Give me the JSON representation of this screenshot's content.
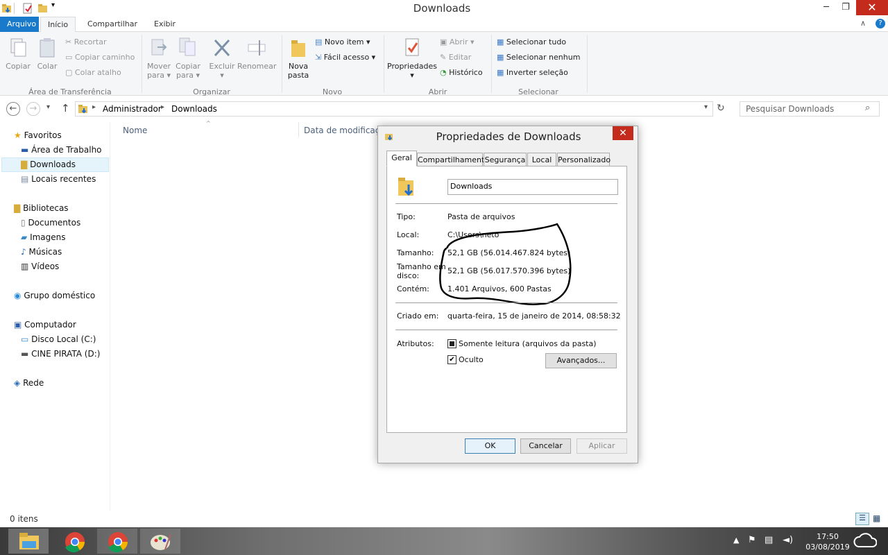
{
  "window": {
    "title": "Downloads",
    "minimize": "─",
    "maximize": "❐",
    "close": "✕"
  },
  "ribbon_tabs": [
    "Arquivo",
    "Início",
    "Compartilhar",
    "Exibir"
  ],
  "ribbon": {
    "copiar": "Copiar",
    "colar": "Colar",
    "recortar": "Recortar",
    "copiar_caminho": "Copiar caminho",
    "colar_atalho": "Colar atalho",
    "group_transferencia": "Área de Transferência",
    "mover_para_1": "Mover",
    "mover_para_2": "para",
    "copiar_para_1": "Copiar",
    "copiar_para_2": "para",
    "excluir": "Excluir",
    "renomear": "Renomear",
    "group_organizar": "Organizar",
    "nova_pasta_1": "Nova",
    "nova_pasta_2": "pasta",
    "novo_item": "Novo item",
    "facil_acesso": "Fácil acesso",
    "group_novo": "Novo",
    "propriedades": "Propriedades",
    "abrir": "Abrir",
    "editar": "Editar",
    "historico": "Histórico",
    "group_abrir": "Abrir",
    "selecionar_tudo": "Selecionar tudo",
    "selecionar_nenhum": "Selecionar nenhum",
    "inverter_selecao": "Inverter seleção",
    "group_selecionar": "Selecionar"
  },
  "address": {
    "crumb1": "Administrador",
    "crumb2": "Downloads",
    "search_placeholder": "Pesquisar Downloads"
  },
  "nav": {
    "favoritos": "Favoritos",
    "area_trabalho": "Área de Trabalho",
    "downloads": "Downloads",
    "locais_recentes": "Locais recentes",
    "bibliotecas": "Bibliotecas",
    "documentos": "Documentos",
    "imagens": "Imagens",
    "musicas": "Músicas",
    "videos": "Vídeos",
    "grupo_domestico": "Grupo doméstico",
    "computador": "Computador",
    "disco_local": "Disco Local (C:)",
    "cine_pirata": "CINE PIRATA (D:)",
    "rede": "Rede"
  },
  "columns": {
    "nome": "Nome",
    "data": "Data de modificaç..."
  },
  "status": {
    "items": "0 itens"
  },
  "dialog": {
    "title": "Propriedades de Downloads",
    "tabs": [
      "Geral",
      "Compartilhamento",
      "Segurança",
      "Local",
      "Personalizado"
    ],
    "name_value": "Downloads",
    "tipo_label": "Tipo:",
    "tipo_value": "Pasta de arquivos",
    "local_label": "Local:",
    "local_value": "C:\\Users\\neto",
    "tamanho_label": "Tamanho:",
    "tamanho_value": "52,1 GB (56.014.467.824 bytes)",
    "tamanho_disco_label_1": "Tamanho em",
    "tamanho_disco_label_2": "disco:",
    "tamanho_disco_value": "52,1 GB (56.017.570.396 bytes)",
    "contem_label": "Contém:",
    "contem_value": "1.401 Arquivos, 600 Pastas",
    "criado_label": "Criado em:",
    "criado_value": "quarta-feira, 15 de janeiro de 2014, 08:58:32",
    "atributos_label": "Atributos:",
    "somente_leitura": "Somente leitura (arquivos da pasta)",
    "oculto": "Oculto",
    "oculto_checked": true,
    "avancados": "Avançados...",
    "ok": "OK",
    "cancelar": "Cancelar",
    "aplicar": "Aplicar"
  },
  "taskbar": {
    "time": "17:50",
    "date": "03/08/2019"
  },
  "colors": {
    "accent": "#1979ca",
    "close": "#c42b1c",
    "annotation": "#000000"
  }
}
